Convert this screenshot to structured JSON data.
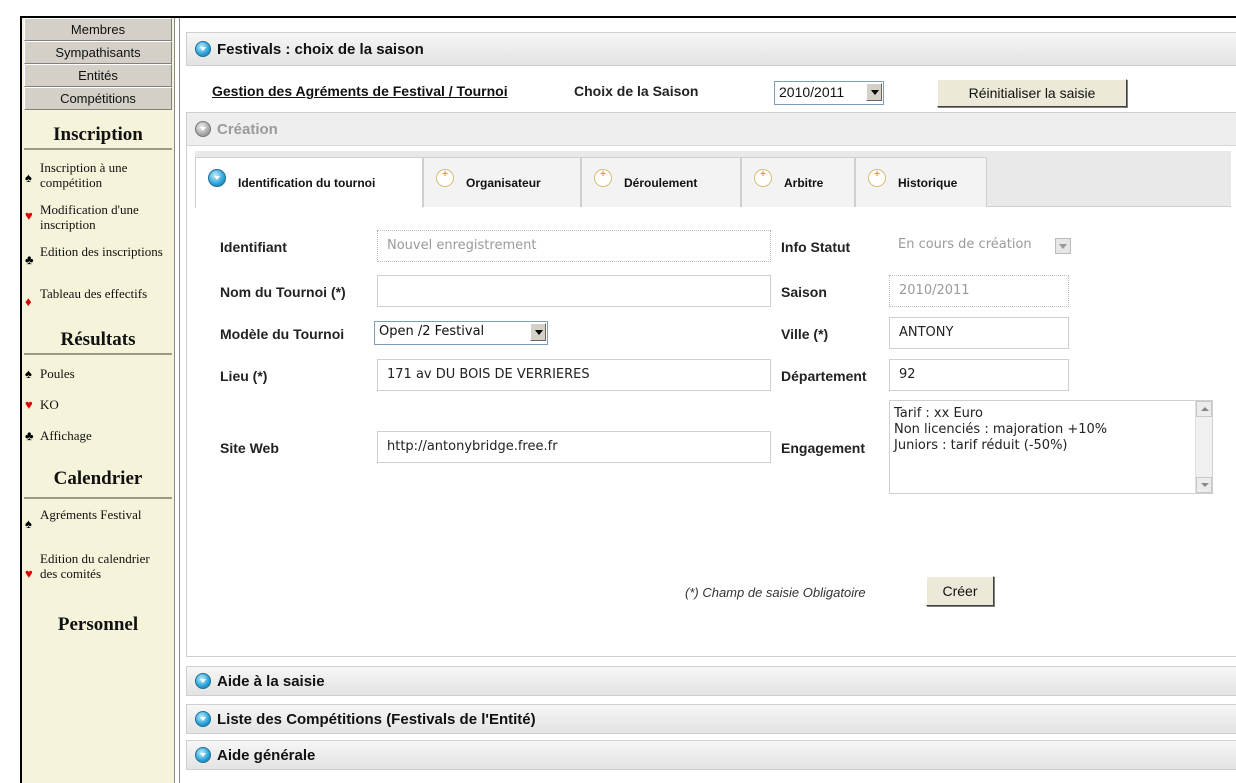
{
  "sidebar": {
    "top_buttons": [
      "Membres",
      "Sympathisants",
      "Entités",
      "Compétitions"
    ],
    "inscription": {
      "title": "Inscription",
      "items": [
        {
          "suit": "♠",
          "color": "black",
          "label": "Inscription à une compétition"
        },
        {
          "suit": "♥",
          "color": "red",
          "label": "Modification d'une inscription"
        },
        {
          "suit": "♣",
          "color": "black",
          "label": "Edition des inscriptions"
        },
        {
          "suit": "♦",
          "color": "red",
          "label": "Tableau des effectifs"
        }
      ]
    },
    "resultats": {
      "title": "Résultats",
      "items": [
        {
          "suit": "♠",
          "color": "black",
          "label": "Poules"
        },
        {
          "suit": "♥",
          "color": "red",
          "label": "KO"
        },
        {
          "suit": "♣",
          "color": "black",
          "label": "Affichage"
        }
      ]
    },
    "calendrier": {
      "title": "Calendrier",
      "items": [
        {
          "suit": "♠",
          "color": "black",
          "label": "Agréments Festival"
        },
        {
          "suit": "♥",
          "color": "red",
          "label": "Edition du calendrier des comités"
        }
      ]
    },
    "personnel": {
      "title": "Personnel"
    }
  },
  "header": {
    "title": "Festivals : choix de la saison"
  },
  "saison_row": {
    "link": "Gestion des Agréments de Festival / Tournoi",
    "choix_label": "Choix de la Saison",
    "saison_value": "2010/2011",
    "reset_button": "Réinitialiser la saisie"
  },
  "creation": {
    "title": "Création",
    "tabs": [
      "Identification du tournoi",
      "Organisateur",
      "Déroulement",
      "Arbitre",
      "Historique"
    ],
    "active_tab": "Identification du tournoi",
    "labels": {
      "identifiant": "Identifiant",
      "nom": "Nom du Tournoi (*)",
      "modele": "Modèle du Tournoi",
      "lieu": "Lieu (*)",
      "site": "Site Web",
      "info_statut": "Info Statut",
      "saison": "Saison",
      "ville": "Ville (*)",
      "departement": "Département",
      "engagement": "Engagement"
    },
    "values": {
      "identifiant": "Nouvel enregistrement",
      "nom": "",
      "modele": "Open /2 Festival",
      "lieu": "171 av DU BOIS DE VERRIERES",
      "site": "http://antonybridge.free.fr",
      "info_statut": "En cours de création",
      "saison": "2010/2011",
      "ville": "ANTONY",
      "departement": "92",
      "engagement_lines": [
        "Tarif : xx Euro",
        "Non licenciés : majoration +10%",
        "Juniors : tarif réduit (-50%)"
      ]
    },
    "note": "(*) Champ de saisie Obligatoire",
    "create_button": "Créer"
  },
  "sections": [
    "Aide à la saisie",
    "Liste des Compétitions (Festivals de l'Entité)",
    "Aide générale"
  ]
}
